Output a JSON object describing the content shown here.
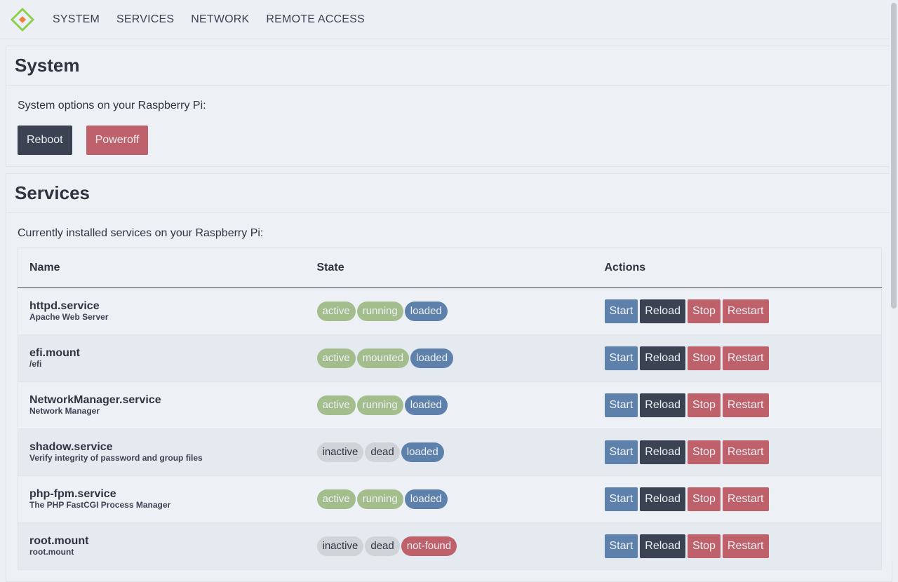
{
  "nav": {
    "items": [
      {
        "label": "SYSTEM"
      },
      {
        "label": "SERVICES"
      },
      {
        "label": "NETWORK"
      },
      {
        "label": "REMOTE ACCESS"
      }
    ]
  },
  "system": {
    "title": "System",
    "intro": "System options on your Raspberry Pi:",
    "reboot_label": "Reboot",
    "poweroff_label": "Poweroff"
  },
  "services": {
    "title": "Services",
    "intro": "Currently installed services on your Raspberry Pi:",
    "headers": {
      "name": "Name",
      "state": "State",
      "actions": "Actions"
    },
    "action_labels": {
      "start": "Start",
      "reload": "Reload",
      "stop": "Stop",
      "restart": "Restart"
    },
    "rows": [
      {
        "name": "httpd.service",
        "desc": "Apache Web Server",
        "states": [
          {
            "text": "active",
            "color": "green"
          },
          {
            "text": "running",
            "color": "green"
          },
          {
            "text": "loaded",
            "color": "blue"
          }
        ]
      },
      {
        "name": "efi.mount",
        "desc": "/efi",
        "states": [
          {
            "text": "active",
            "color": "green"
          },
          {
            "text": "mounted",
            "color": "green"
          },
          {
            "text": "loaded",
            "color": "blue"
          }
        ]
      },
      {
        "name": "NetworkManager.service",
        "desc": "Network Manager",
        "states": [
          {
            "text": "active",
            "color": "green"
          },
          {
            "text": "running",
            "color": "green"
          },
          {
            "text": "loaded",
            "color": "blue"
          }
        ]
      },
      {
        "name": "shadow.service",
        "desc": "Verify integrity of password and group files",
        "states": [
          {
            "text": "inactive",
            "color": "gray"
          },
          {
            "text": "dead",
            "color": "gray"
          },
          {
            "text": "loaded",
            "color": "blue"
          }
        ]
      },
      {
        "name": "php-fpm.service",
        "desc": "The PHP FastCGI Process Manager",
        "states": [
          {
            "text": "active",
            "color": "green"
          },
          {
            "text": "running",
            "color": "green"
          },
          {
            "text": "loaded",
            "color": "blue"
          }
        ]
      },
      {
        "name": "root.mount",
        "desc": "root.mount",
        "states": [
          {
            "text": "inactive",
            "color": "gray"
          },
          {
            "text": "dead",
            "color": "gray"
          },
          {
            "text": "not-found",
            "color": "red"
          }
        ]
      }
    ]
  },
  "colors": {
    "background": "#eceff4",
    "dark": "#3b4252",
    "red": "#bf616a",
    "blue": "#5e81ac",
    "green": "#a3be8c"
  }
}
